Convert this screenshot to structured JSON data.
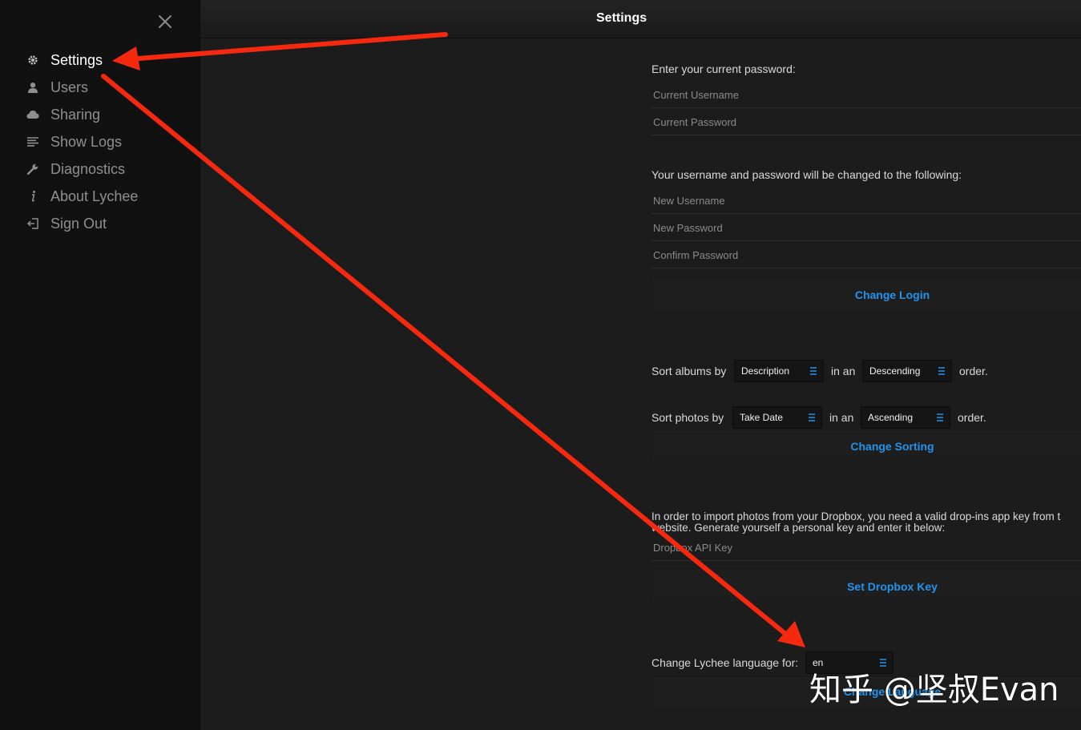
{
  "sidebar": {
    "items": [
      {
        "label": "Settings",
        "icon": "gear-icon"
      },
      {
        "label": "Users",
        "icon": "user-icon"
      },
      {
        "label": "Sharing",
        "icon": "cloud-icon"
      },
      {
        "label": "Show Logs",
        "icon": "list-icon"
      },
      {
        "label": "Diagnostics",
        "icon": "wrench-icon"
      },
      {
        "label": "About Lychee",
        "icon": "info-icon"
      },
      {
        "label": "Sign Out",
        "icon": "sign-out-icon"
      }
    ]
  },
  "header": {
    "title": "Settings"
  },
  "login": {
    "current_prompt": "Enter your current password:",
    "current_username_placeholder": "Current Username",
    "current_password_placeholder": "Current Password",
    "new_prompt": "Your username and password will be changed to the following:",
    "new_username_placeholder": "New Username",
    "new_password_placeholder": "New Password",
    "confirm_password_placeholder": "Confirm Password",
    "button": "Change Login"
  },
  "sorting": {
    "albums_prefix": "Sort albums by",
    "albums_by": "Description",
    "in_an": "in an",
    "albums_order": "Descending",
    "order_suffix": "order.",
    "photos_prefix": "Sort photos by",
    "photos_by": "Take Date",
    "photos_order": "Ascending",
    "button": "Change Sorting"
  },
  "dropbox": {
    "text_line1": "In order to import photos from your Dropbox, you need a valid drop-ins app key from t",
    "text_line2": "website. Generate yourself a personal key and enter it below:",
    "placeholder": "Dropbox API Key",
    "button": "Set Dropbox Key"
  },
  "language": {
    "label": "Change Lychee language for:",
    "value": "en",
    "button": "Change Language"
  },
  "watermark": "知乎 @坚叔Evan",
  "colors": {
    "accent": "#2293ec",
    "annotation_arrow": "#f4290f",
    "sidebar_bg": "#111111",
    "content_bg": "#1c1c1c"
  }
}
